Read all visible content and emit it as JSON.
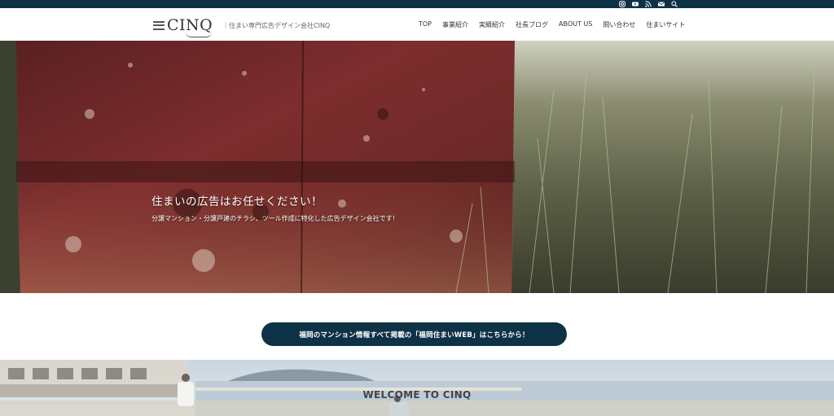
{
  "header": {
    "logo_text": "CINQ",
    "tagline": "｜住まい専門広告デザイン会社CINQ"
  },
  "social_icons": [
    "instagram-icon",
    "youtube-icon",
    "rss-icon",
    "mail-icon",
    "search-icon"
  ],
  "nav": {
    "items": [
      {
        "label": "TOP"
      },
      {
        "label": "事業紹介"
      },
      {
        "label": "実績紹介"
      },
      {
        "label": "社長ブログ"
      },
      {
        "label": "ABOUT US"
      },
      {
        "label": "問い合わせ"
      },
      {
        "label": "住まいサイト"
      }
    ]
  },
  "hero": {
    "title": "住まいの広告はお任せください！",
    "subtitle": "分譲マンション・分譲戸建のチラシ、ツール作成に特化した広告デザイン会社です！"
  },
  "cta": {
    "label": "福岡のマンション情報すべて掲載の「福岡住まいWEB」はこちらから！"
  },
  "welcome": {
    "title": "WELCOME TO CINQ"
  },
  "colors": {
    "topbar": "#0e3245",
    "cta_bg": "#0e3245",
    "hero_rust": "#7a2a2a",
    "hero_grass": "#6b6f52"
  }
}
